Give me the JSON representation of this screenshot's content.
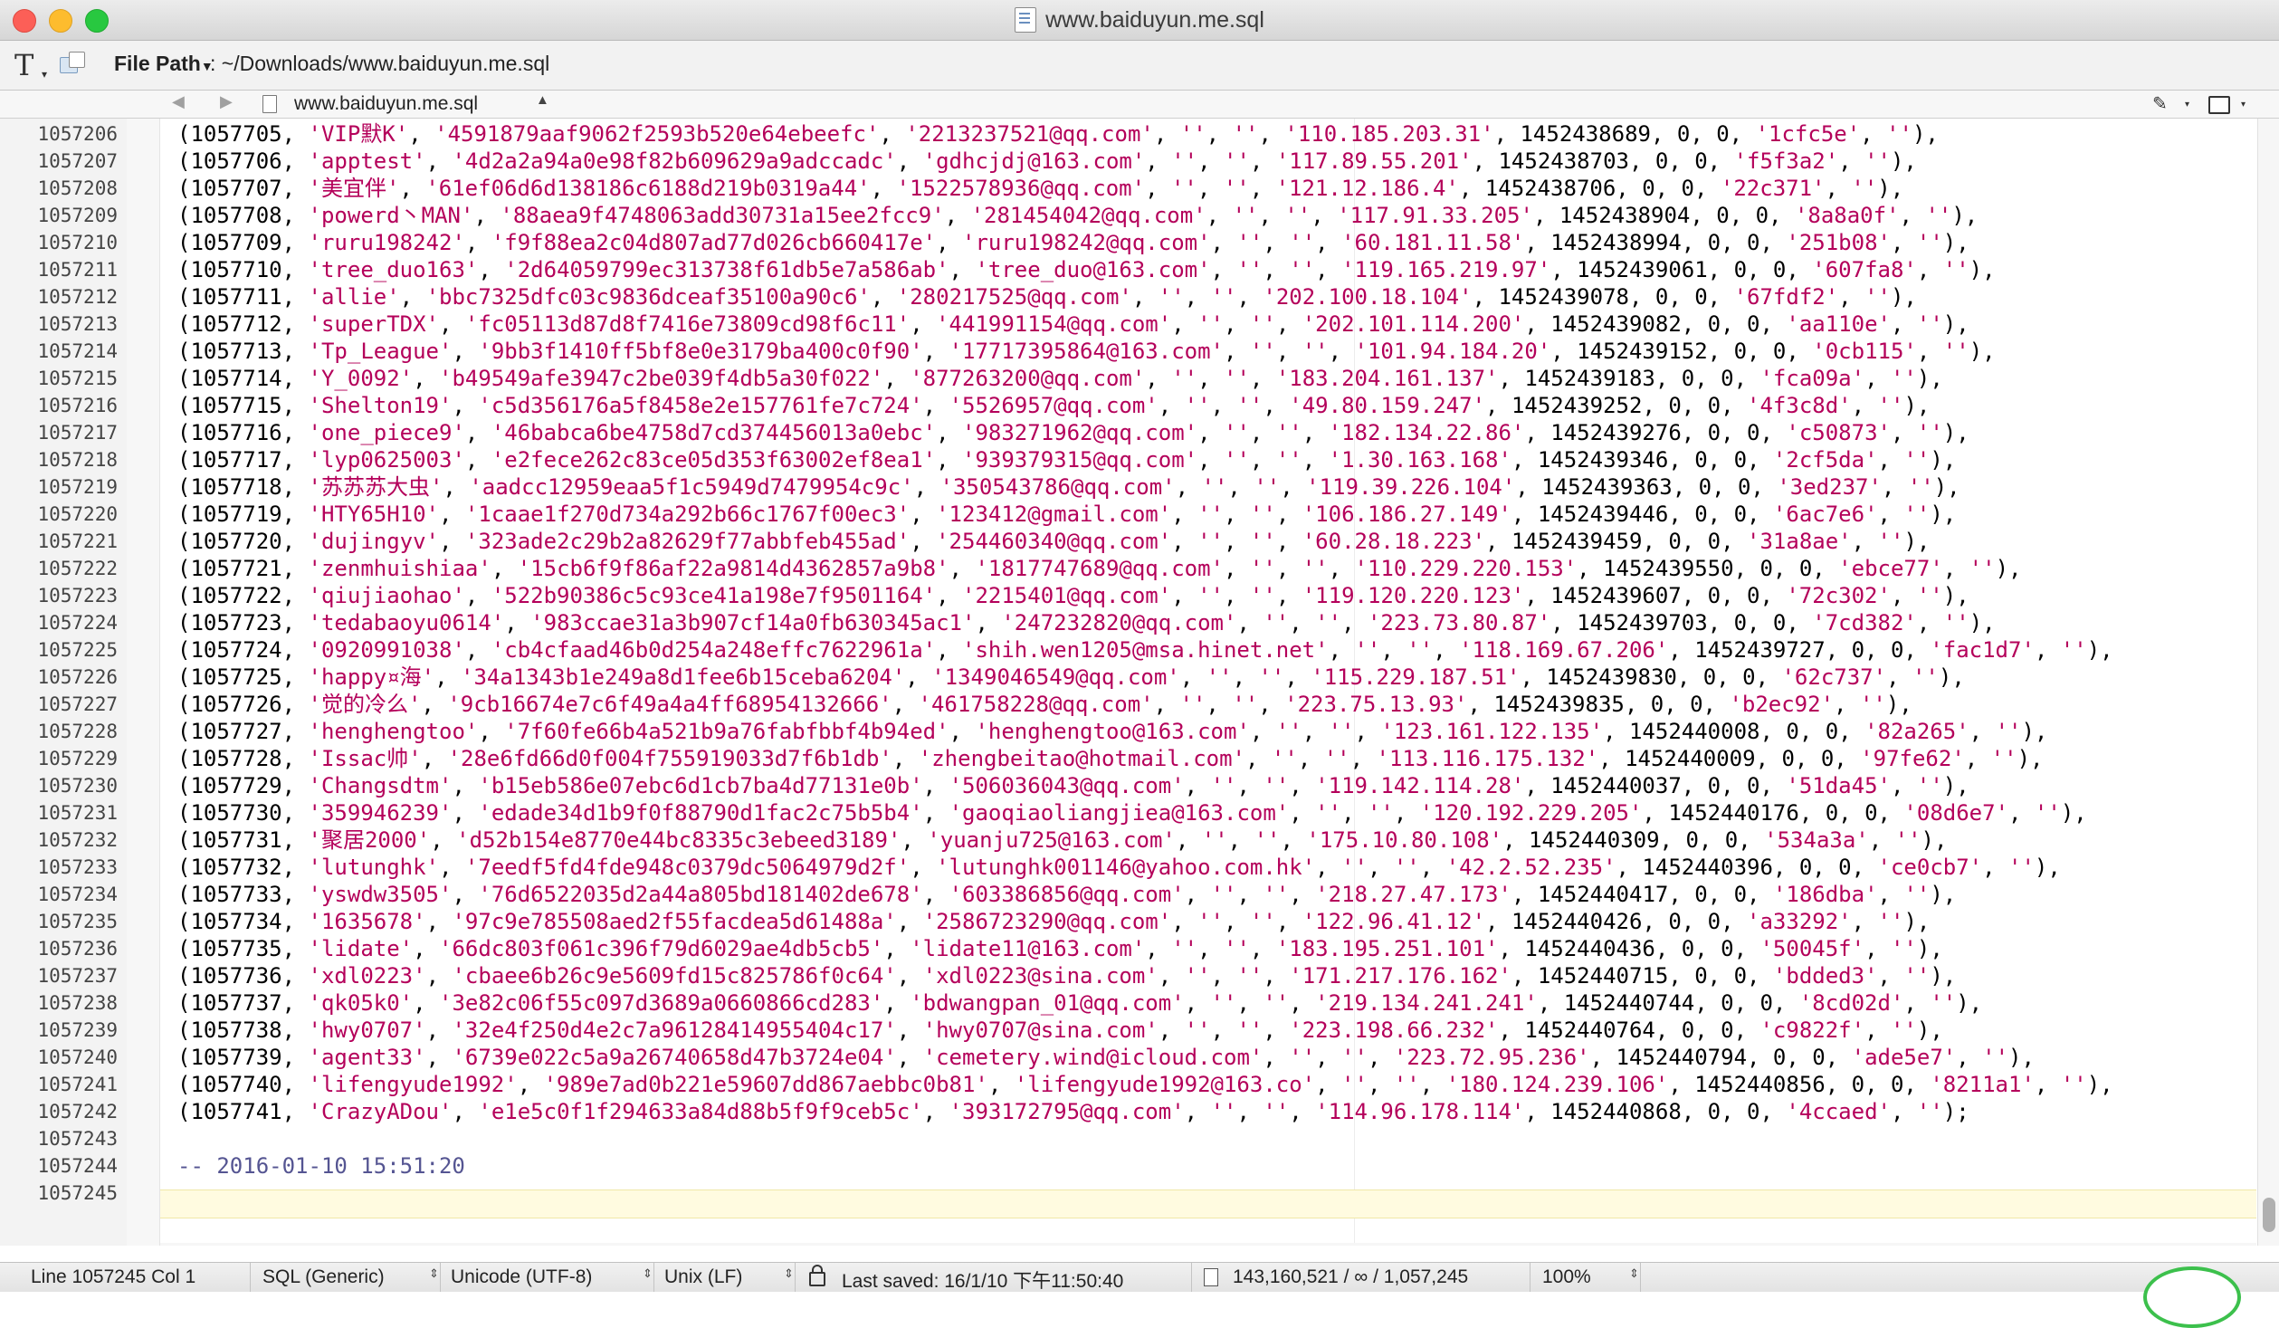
{
  "window": {
    "title": "www.baiduyun.me.sql"
  },
  "toolbar": {
    "file_path_label": "File Path",
    "file_path_value": ": ~/Downloads/www.baiduyun.me.sql"
  },
  "nav": {
    "file_name": "www.baiduyun.me.sql"
  },
  "editor": {
    "lines": [
      {
        "num": "1057206",
        "id": "1057705",
        "user": "'VIP默K'",
        "hash": "'4591879aaf9062f2593b520e64ebeefc'",
        "email": "'2213237521@qq.com'",
        "ip": "'110.185.203.31'",
        "ts": "1452438689",
        "salt": "'1cfc5e'"
      },
      {
        "num": "1057207",
        "id": "1057706",
        "user": "'apptest'",
        "hash": "'4d2a2a94a0e98f82b609629a9adccadc'",
        "email": "'gdhcjdj@163.com'",
        "ip": "'117.89.55.201'",
        "ts": "1452438703",
        "salt": "'f5f3a2'"
      },
      {
        "num": "1057208",
        "id": "1057707",
        "user": "'美宜伴'",
        "hash": "'61ef06d6d138186c6188d219b0319a44'",
        "email": "'1522578936@qq.com'",
        "ip": "'121.12.186.4'",
        "ts": "1452438706",
        "salt": "'22c371'"
      },
      {
        "num": "1057209",
        "id": "1057708",
        "user": "'powerd丶MAN'",
        "hash": "'88aea9f4748063add30731a15ee2fcc9'",
        "email": "'281454042@qq.com'",
        "ip": "'117.91.33.205'",
        "ts": "1452438904",
        "salt": "'8a8a0f'"
      },
      {
        "num": "1057210",
        "id": "1057709",
        "user": "'ruru198242'",
        "hash": "'f9f88ea2c04d807ad77d026cb660417e'",
        "email": "'ruru198242@qq.com'",
        "ip": "'60.181.11.58'",
        "ts": "1452438994",
        "salt": "'251b08'"
      },
      {
        "num": "1057211",
        "id": "1057710",
        "user": "'tree_duo163'",
        "hash": "'2d64059799ec313738f61db5e7a586ab'",
        "email": "'tree_duo@163.com'",
        "ip": "'119.165.219.97'",
        "ts": "1452439061",
        "salt": "'607fa8'"
      },
      {
        "num": "1057212",
        "id": "1057711",
        "user": "'allie'",
        "hash": "'bbc7325dfc03c9836dceaf35100a90c6'",
        "email": "'280217525@qq.com'",
        "ip": "'202.100.18.104'",
        "ts": "1452439078",
        "salt": "'67fdf2'"
      },
      {
        "num": "1057213",
        "id": "1057712",
        "user": "'superTDX'",
        "hash": "'fc05113d87d8f7416e73809cd98f6c11'",
        "email": "'441991154@qq.com'",
        "ip": "'202.101.114.200'",
        "ts": "1452439082",
        "salt": "'aa110e'"
      },
      {
        "num": "1057214",
        "id": "1057713",
        "user": "'Tp_League'",
        "hash": "'9bb3f1410ff5bf8e0e3179ba400c0f90'",
        "email": "'17717395864@163.com'",
        "ip": "'101.94.184.20'",
        "ts": "1452439152",
        "salt": "'0cb115'"
      },
      {
        "num": "1057215",
        "id": "1057714",
        "user": "'Y_0092'",
        "hash": "'b49549afe3947c2be039f4db5a30f022'",
        "email": "'877263200@qq.com'",
        "ip": "'183.204.161.137'",
        "ts": "1452439183",
        "salt": "'fca09a'"
      },
      {
        "num": "1057216",
        "id": "1057715",
        "user": "'Shelton19'",
        "hash": "'c5d356176a5f8458e2e157761fe7c724'",
        "email": "'5526957@qq.com'",
        "ip": "'49.80.159.247'",
        "ts": "1452439252",
        "salt": "'4f3c8d'"
      },
      {
        "num": "1057217",
        "id": "1057716",
        "user": "'one_piece9'",
        "hash": "'46babca6be4758d7cd374456013a0ebc'",
        "email": "'983271962@qq.com'",
        "ip": "'182.134.22.86'",
        "ts": "1452439276",
        "salt": "'c50873'"
      },
      {
        "num": "1057218",
        "id": "1057717",
        "user": "'lyp0625003'",
        "hash": "'e2fece262c83ce05d353f63002ef8ea1'",
        "email": "'939379315@qq.com'",
        "ip": "'1.30.163.168'",
        "ts": "1452439346",
        "salt": "'2cf5da'"
      },
      {
        "num": "1057219",
        "id": "1057718",
        "user": "'苏苏苏大虫'",
        "hash": "'aadcc12959eaa5f1c5949d7479954c9c'",
        "email": "'350543786@qq.com'",
        "ip": "'119.39.226.104'",
        "ts": "1452439363",
        "salt": "'3ed237'"
      },
      {
        "num": "1057220",
        "id": "1057719",
        "user": "'HTY65H10'",
        "hash": "'1caae1f270d734a292b66c1767f00ec3'",
        "email": "'123412@gmail.com'",
        "ip": "'106.186.27.149'",
        "ts": "1452439446",
        "salt": "'6ac7e6'"
      },
      {
        "num": "1057221",
        "id": "1057720",
        "user": "'dujingyv'",
        "hash": "'323ade2c29b2a82629f77abbfeb455ad'",
        "email": "'254460340@qq.com'",
        "ip": "'60.28.18.223'",
        "ts": "1452439459",
        "salt": "'31a8ae'"
      },
      {
        "num": "1057222",
        "id": "1057721",
        "user": "'zenmhuishiaa'",
        "hash": "'15cb6f9f86af22a9814d4362857a9b8'",
        "email": "'1817747689@qq.com'",
        "ip": "'110.229.220.153'",
        "ts": "1452439550",
        "salt": "'ebce77'"
      },
      {
        "num": "1057223",
        "id": "1057722",
        "user": "'qiujiaohao'",
        "hash": "'522b90386c5c93ce41a198e7f9501164'",
        "email": "'2215401@qq.com'",
        "ip": "'119.120.220.123'",
        "ts": "1452439607",
        "salt": "'72c302'"
      },
      {
        "num": "1057224",
        "id": "1057723",
        "user": "'tedabaoyu0614'",
        "hash": "'983ccae31a3b907cf14a0fb630345ac1'",
        "email": "'247232820@qq.com'",
        "ip": "'223.73.80.87'",
        "ts": "1452439703",
        "salt": "'7cd382'"
      },
      {
        "num": "1057225",
        "id": "1057724",
        "user": "'0920991038'",
        "hash": "'cb4cfaad46b0d254a248effc7622961a'",
        "email": "'shih.wen1205@msa.hinet.net'",
        "ip": "'118.169.67.206'",
        "ts": "1452439727",
        "salt": "'fac1d7'"
      },
      {
        "num": "1057226",
        "id": "1057725",
        "user": "'happy¤海'",
        "hash": "'34a1343b1e249a8d1fee6b15ceba6204'",
        "email": "'1349046549@qq.com'",
        "ip": "'115.229.187.51'",
        "ts": "1452439830",
        "salt": "'62c737'"
      },
      {
        "num": "1057227",
        "id": "1057726",
        "user": "'觉的冷么'",
        "hash": "'9cb16674e7c6f49a4a4ff68954132666'",
        "email": "'461758228@qq.com'",
        "ip": "'223.75.13.93'",
        "ts": "1452439835",
        "salt": "'b2ec92'"
      },
      {
        "num": "1057228",
        "id": "1057727",
        "user": "'henghengtoo'",
        "hash": "'7f60fe66b4a521b9a76fabfbbf4b94ed'",
        "email": "'henghengtoo@163.com'",
        "ip": "'123.161.122.135'",
        "ts": "1452440008",
        "salt": "'82a265'"
      },
      {
        "num": "1057229",
        "id": "1057728",
        "user": "'Issac帅'",
        "hash": "'28e6fd66d0f004f755919033d7f6b1db'",
        "email": "'zhengbeitao@hotmail.com'",
        "ip": "'113.116.175.132'",
        "ts": "1452440009",
        "salt": "'97fe62'"
      },
      {
        "num": "1057230",
        "id": "1057729",
        "user": "'Changsdtm'",
        "hash": "'b15eb586e07ebc6d1cb7ba4d77131e0b'",
        "email": "'506036043@qq.com'",
        "ip": "'119.142.114.28'",
        "ts": "1452440037",
        "salt": "'51da45'"
      },
      {
        "num": "1057231",
        "id": "1057730",
        "user": "'359946239'",
        "hash": "'edade34d1b9f0f88790d1fac2c75b5b4'",
        "email": "'gaoqiaoliangjiea@163.com'",
        "ip": "'120.192.229.205'",
        "ts": "1452440176",
        "salt": "'08d6e7'"
      },
      {
        "num": "1057232",
        "id": "1057731",
        "user": "'聚居2000'",
        "hash": "'d52b154e8770e44bc8335c3ebeed3189'",
        "email": "'yuanju725@163.com'",
        "ip": "'175.10.80.108'",
        "ts": "1452440309",
        "salt": "'534a3a'"
      },
      {
        "num": "1057233",
        "id": "1057732",
        "user": "'lutunghk'",
        "hash": "'7eedf5fd4fde948c0379dc5064979d2f'",
        "email": "'lutunghk001146@yahoo.com.hk'",
        "ip": "'42.2.52.235'",
        "ts": "1452440396",
        "salt": "'ce0cb7'"
      },
      {
        "num": "1057234",
        "id": "1057733",
        "user": "'yswdw3505'",
        "hash": "'76d6522035d2a44a805bd181402de678'",
        "email": "'603386856@qq.com'",
        "ip": "'218.27.47.173'",
        "ts": "1452440417",
        "salt": "'186dba'"
      },
      {
        "num": "1057235",
        "id": "1057734",
        "user": "'1635678'",
        "hash": "'97c9e785508aed2f55facdea5d61488a'",
        "email": "'2586723290@qq.com'",
        "ip": "'122.96.41.12'",
        "ts": "1452440426",
        "salt": "'a33292'"
      },
      {
        "num": "1057236",
        "id": "1057735",
        "user": "'lidate'",
        "hash": "'66dc803f061c396f79d6029ae4db5cb5'",
        "email": "'lidate11@163.com'",
        "ip": "'183.195.251.101'",
        "ts": "1452440436",
        "salt": "'50045f'"
      },
      {
        "num": "1057237",
        "id": "1057736",
        "user": "'xdl0223'",
        "hash": "'cbaee6b26c9e5609fd15c825786f0c64'",
        "email": "'xdl0223@sina.com'",
        "ip": "'171.217.176.162'",
        "ts": "1452440715",
        "salt": "'bdded3'"
      },
      {
        "num": "1057238",
        "id": "1057737",
        "user": "'qk05k0'",
        "hash": "'3e82c06f55c097d3689a0660866cd283'",
        "email": "'bdwangpan_01@qq.com'",
        "ip": "'219.134.241.241'",
        "ts": "1452440744",
        "salt": "'8cd02d'"
      },
      {
        "num": "1057239",
        "id": "1057738",
        "user": "'hwy0707'",
        "hash": "'32e4f250d4e2c7a96128414955404c17'",
        "email": "'hwy0707@sina.com'",
        "ip": "'223.198.66.232'",
        "ts": "1452440764",
        "salt": "'c9822f'"
      },
      {
        "num": "1057240",
        "id": "1057739",
        "user": "'agent33'",
        "hash": "'6739e022c5a9a26740658d47b3724e04'",
        "email": "'cemetery.wind@icloud.com'",
        "ip": "'223.72.95.236'",
        "ts": "1452440794",
        "salt": "'ade5e7'"
      },
      {
        "num": "1057241",
        "id": "1057740",
        "user": "'lifengyude1992'",
        "hash": "'989e7ad0b221e59607dd867aebbc0b81'",
        "email": "'lifengyude1992@163.co'",
        "ip": "'180.124.239.106'",
        "ts": "1452440856",
        "salt": "'8211a1'"
      },
      {
        "num": "1057242",
        "id": "1057741",
        "user": "'CrazyADou'",
        "hash": "'e1e5c0f1f294633a84d88b5f9f9ceb5c'",
        "email": "'393172795@qq.com'",
        "ip": "'114.96.178.114'",
        "ts": "1452440868",
        "salt": "'4ccaed'",
        "last": true
      }
    ],
    "trailing_lines": [
      {
        "num": "1057243",
        "text": ""
      },
      {
        "num": "1057244",
        "text": "-- 2016-01-10 15:51:20"
      },
      {
        "num": "1057245",
        "text": ""
      }
    ]
  },
  "status": {
    "position": "Line 1057245 Col 1",
    "language": "SQL (Generic)",
    "encoding": "Unicode (UTF-8)",
    "line_endings": "Unix (LF)",
    "last_saved": "Last saved: 16/1/10 下午11:50:40",
    "stats": "143,160,521 / ∞ / 1,057,245",
    "zoom": "100%"
  }
}
